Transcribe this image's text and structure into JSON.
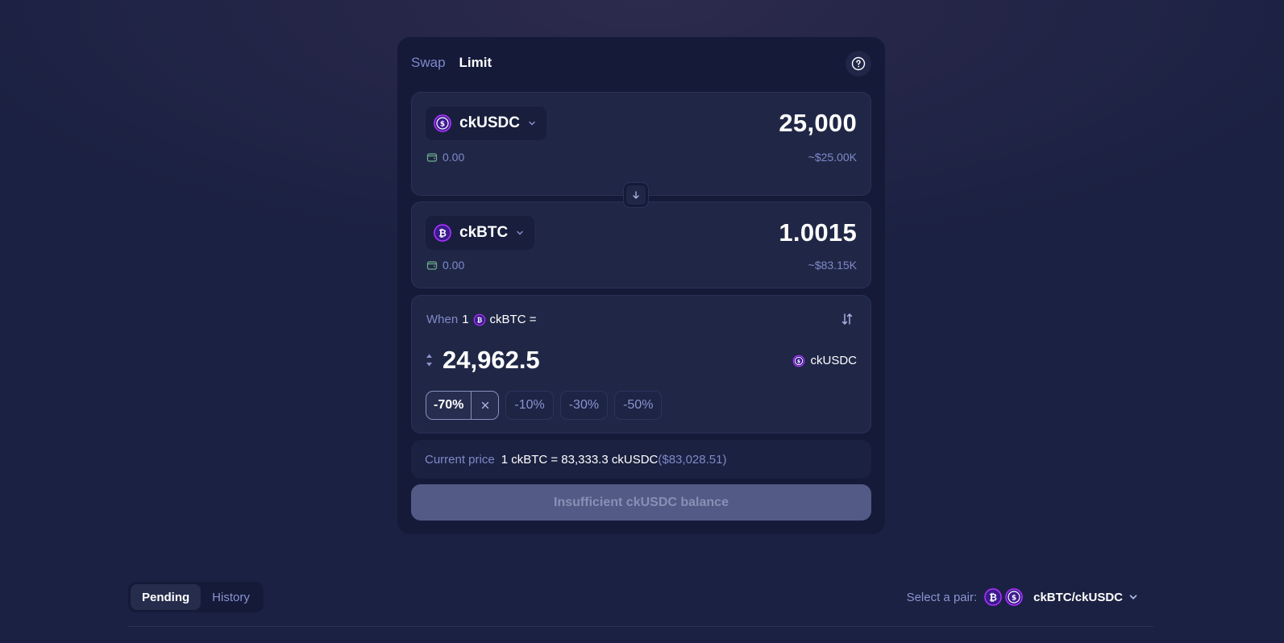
{
  "tabs": [
    {
      "label": "Swap",
      "active": false
    },
    {
      "label": "Limit",
      "active": true
    }
  ],
  "from": {
    "token": "ckUSDC",
    "amount": "25,000",
    "balance": "0.00",
    "usd": "~$25.00K"
  },
  "to": {
    "token": "ckBTC",
    "amount": "1.0015",
    "balance": "0.00",
    "usd": "~$83.15K"
  },
  "limit": {
    "when_label": "When",
    "when_value": "1",
    "base_token": "ckBTC =",
    "price": "24,962.5",
    "quote_token": "ckUSDC",
    "chips": [
      {
        "label": "-70%",
        "active": true
      },
      {
        "label": "-10%",
        "active": false
      },
      {
        "label": "-30%",
        "active": false
      },
      {
        "label": "-50%",
        "active": false
      }
    ]
  },
  "current_price": {
    "label": "Current price",
    "value": "1 ckBTC = 83,333.3 ckUSDC",
    "usd": "($83,028.51)"
  },
  "cta_label": "Insufficient ckUSDC balance",
  "orders": {
    "tabs": [
      {
        "label": "Pending",
        "active": true
      },
      {
        "label": "History",
        "active": false
      }
    ],
    "pair_label": "Select a pair:",
    "pair_value": "ckBTC/ckUSDC"
  },
  "colors": {
    "background": "#1b2142",
    "card": "#141a38",
    "panel": "#202746",
    "muted_text": "#7f89c9",
    "coin_purple": "#5b2bd6",
    "coin_ring": "#9b5cff",
    "cta_disabled": "#525a85"
  },
  "icons": [
    "help-icon",
    "usdc-coin-icon",
    "btc-coin-icon",
    "chevron-down-icon",
    "wallet-icon",
    "arrow-down-icon",
    "swap-vertical-icon",
    "stepper-icon",
    "close-icon"
  ]
}
